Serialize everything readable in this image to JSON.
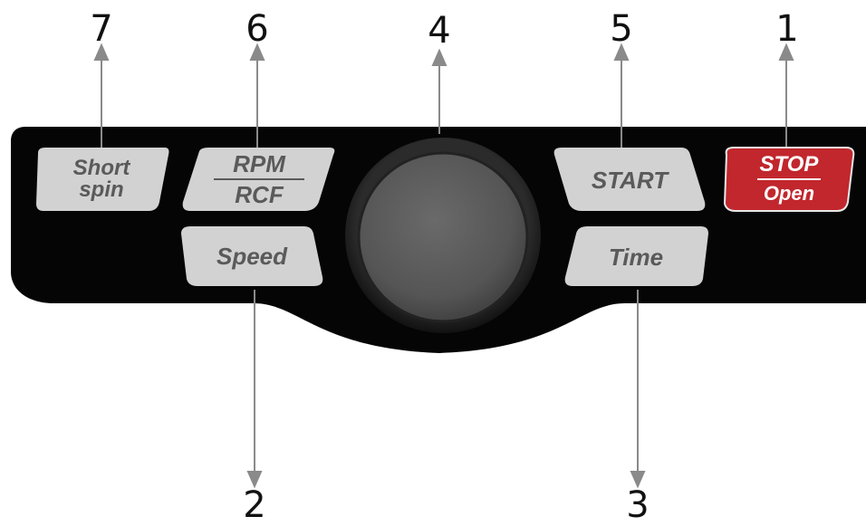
{
  "callouts": {
    "n1": "1",
    "n2": "2",
    "n3": "3",
    "n4": "4",
    "n5": "5",
    "n6": "6",
    "n7": "7"
  },
  "buttons": {
    "short_spin": {
      "line1": "Short",
      "line2": "spin"
    },
    "rpm_rcf": {
      "top": "RPM",
      "bottom": "RCF"
    },
    "speed": "Speed",
    "start": "START",
    "time": "Time",
    "stop_open": {
      "top": "STOP",
      "bottom": "Open"
    }
  },
  "colors": {
    "panel": "#050505",
    "button": "#d2d2d2",
    "button_text": "#5a5a5a",
    "stop": "#c1272d",
    "knob": "#555555",
    "arrow": "#8a8a8a"
  },
  "icons": {
    "knob": "rotary-knob"
  }
}
